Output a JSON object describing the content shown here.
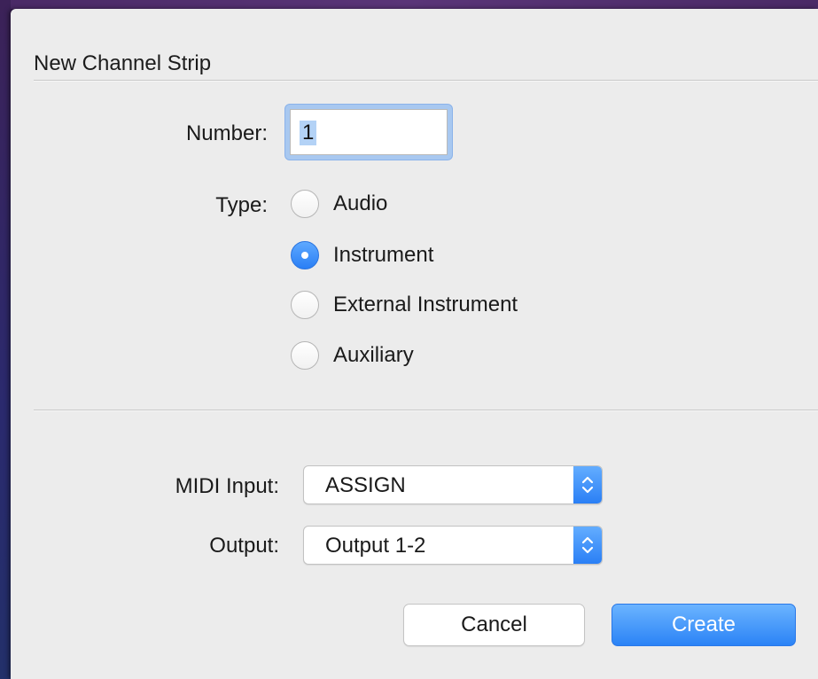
{
  "dialog": {
    "title": "New Channel Strip"
  },
  "number": {
    "label": "Number:",
    "value": "1"
  },
  "type": {
    "label": "Type:",
    "options": [
      {
        "label": "Audio",
        "checked": false
      },
      {
        "label": "Instrument",
        "checked": true
      },
      {
        "label": "External Instrument",
        "checked": false
      },
      {
        "label": "Auxiliary",
        "checked": false
      }
    ]
  },
  "midi_input": {
    "label": "MIDI Input:",
    "value": "ASSIGN"
  },
  "output": {
    "label": "Output:",
    "value": "Output 1-2"
  },
  "buttons": {
    "cancel": "Cancel",
    "create": "Create"
  },
  "colors": {
    "accent": "#2a7ff5",
    "dialog_bg": "#ececec"
  }
}
